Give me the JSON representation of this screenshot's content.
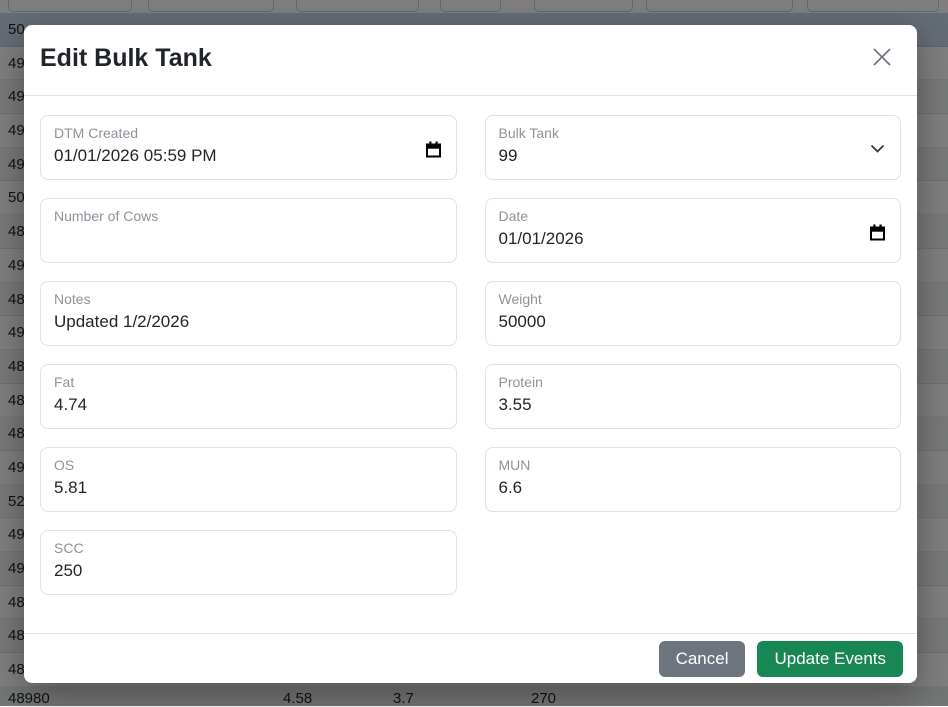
{
  "modal": {
    "title": "Edit Bulk Tank",
    "fields": {
      "dtm_created": {
        "label": "DTM Created",
        "value": "01/01/2026 05:59 PM"
      },
      "bulk_tank": {
        "label": "Bulk Tank",
        "value": "99"
      },
      "number_of_cows": {
        "label": "Number of Cows",
        "value": ""
      },
      "date": {
        "label": "Date",
        "value": "01/01/2026"
      },
      "notes": {
        "label": "Notes",
        "value": "Updated 1/2/2026"
      },
      "weight": {
        "label": "Weight",
        "value": "50000"
      },
      "fat": {
        "label": "Fat",
        "value": "4.74"
      },
      "protein": {
        "label": "Protein",
        "value": "3.55"
      },
      "os": {
        "label": "OS",
        "value": "5.81"
      },
      "mun": {
        "label": "MUN",
        "value": "6.6"
      },
      "scc": {
        "label": "SCC",
        "value": "250"
      }
    },
    "footer": {
      "cancel_label": "Cancel",
      "update_label": "Update Events"
    },
    "colors": {
      "accent_green": "#198754",
      "cancel_gray": "#6c757d"
    }
  },
  "background": {
    "rows": [
      "50",
      "49",
      "49",
      "49",
      "49",
      "50",
      "48",
      "49",
      "48",
      "49",
      "48",
      "48",
      "48",
      "49",
      "52",
      "49",
      "49",
      "48",
      "48",
      "48"
    ],
    "bottom_row": {
      "weight": "48980",
      "fat": "4.58",
      "protein": "3.7",
      "scc": "270"
    }
  }
}
